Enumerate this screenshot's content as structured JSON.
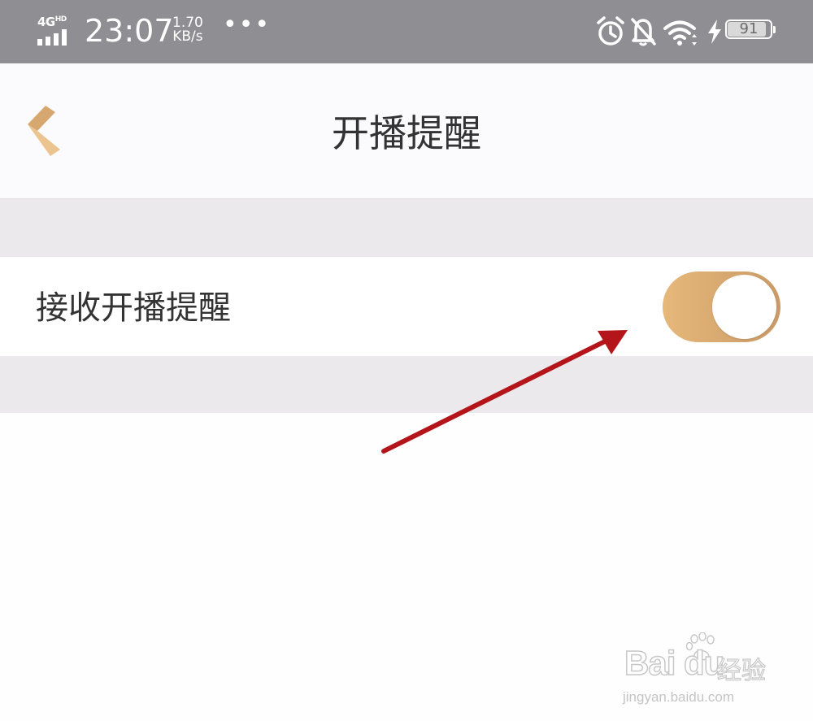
{
  "status_bar": {
    "network": "4G",
    "network_sup": "HD",
    "time": "23:07",
    "speed_value": "1.70",
    "speed_unit": "KB/s",
    "more": "•••",
    "icons": [
      "alarm-icon",
      "notifications-off-icon",
      "wifi-icon",
      "charging-bolt-icon"
    ],
    "battery_level": 91,
    "battery_label": "91"
  },
  "nav": {
    "back_icon": "chevron-left-icon",
    "title": "开播提醒"
  },
  "settings": {
    "item_label": "接收开播提醒",
    "toggle_on": true
  },
  "watermark": {
    "brand": "Bai du",
    "suffix": "经验",
    "url": "jingyan.baidu.com"
  },
  "colors": {
    "accent": "#d6a86f",
    "status_bar_bg": "#8f8e92",
    "arrow": "#b4151b",
    "band": "#ebe9ec"
  }
}
